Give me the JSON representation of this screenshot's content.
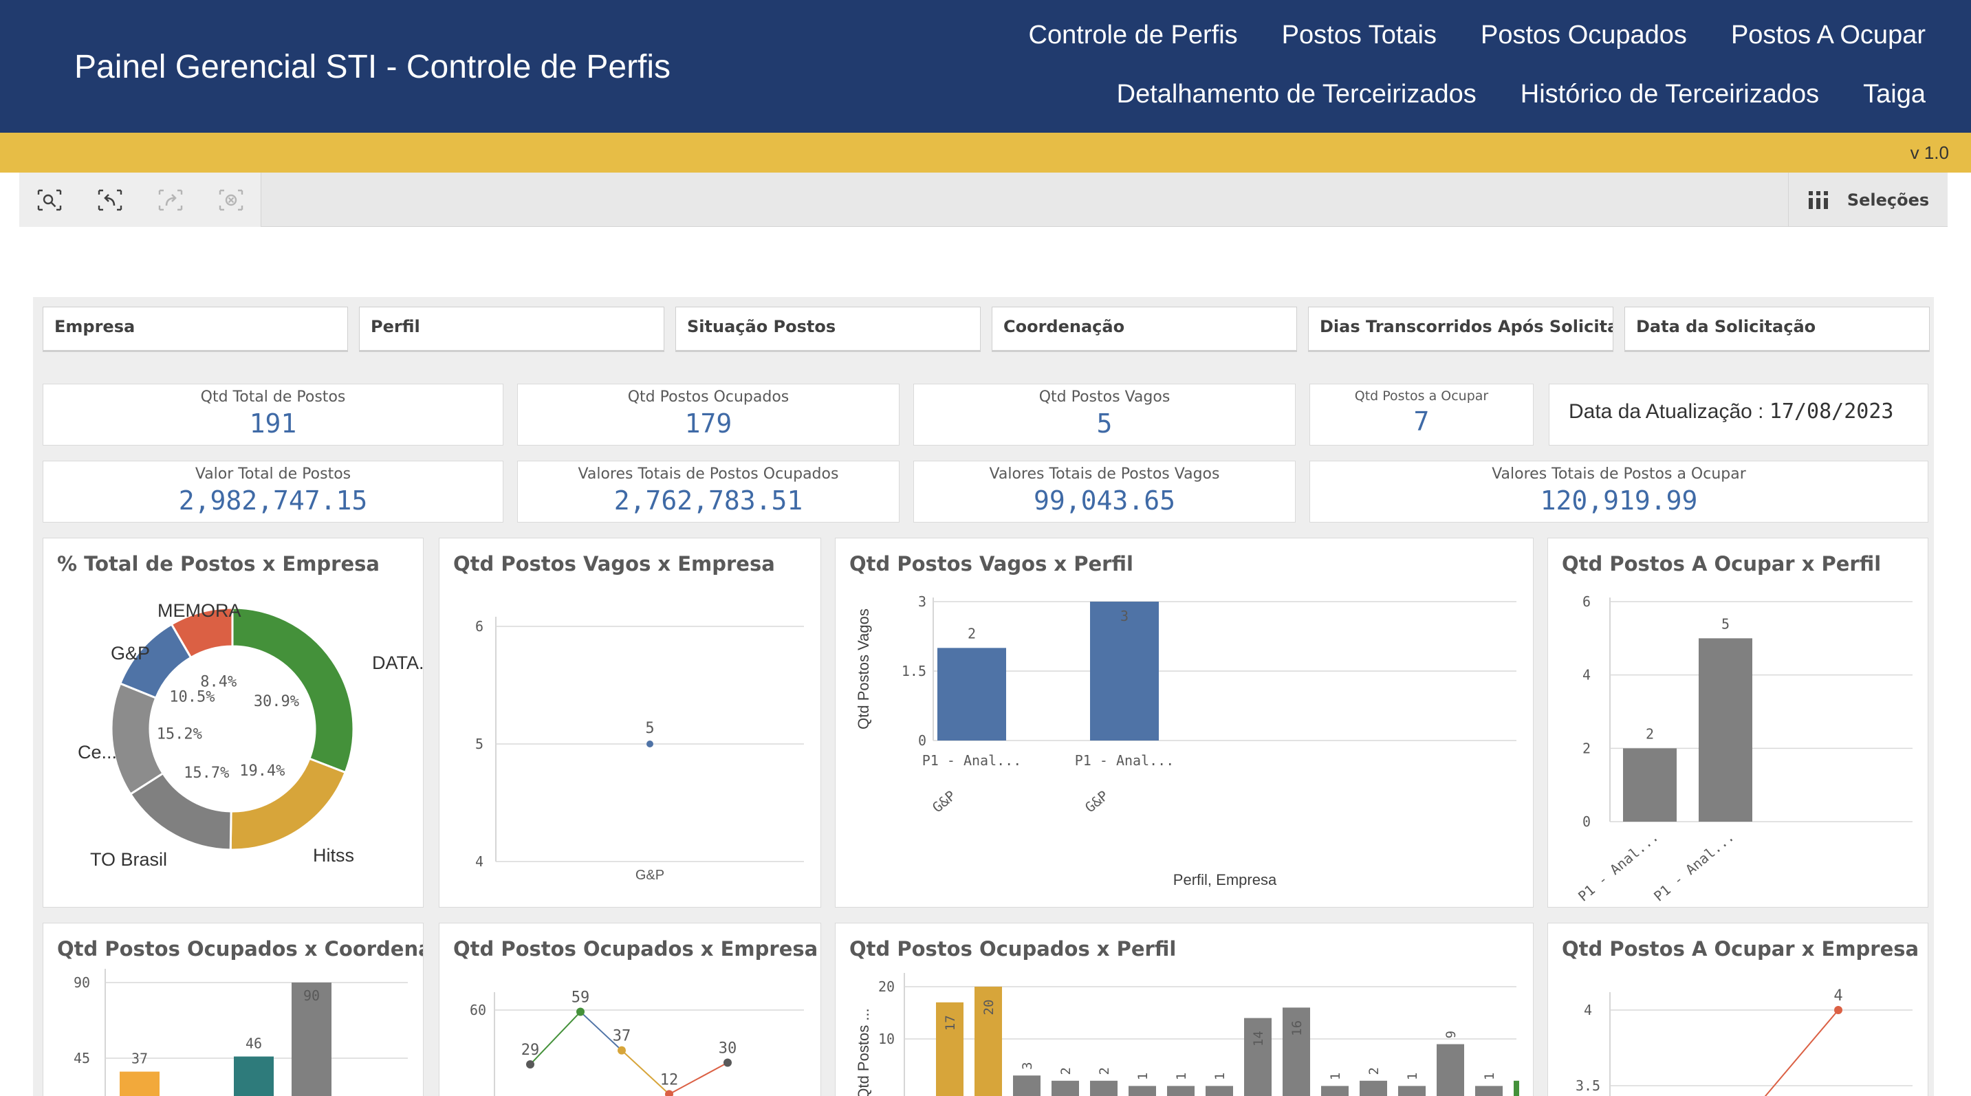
{
  "header": {
    "title": "Painel Gerencial STI - Controle de Perfis",
    "nav_row1": [
      "Controle de Perfis",
      "Postos Totais",
      "Postos Ocupados",
      "Postos A Ocupar"
    ],
    "nav_row2": [
      "Detalhamento de Terceirizados",
      "Histórico de Terceirizados",
      "Taiga"
    ]
  },
  "version": "v 1.0",
  "toolbar": {
    "tools": [
      "smart-search-icon",
      "step-back-icon",
      "step-forward-icon",
      "clear-selections-icon"
    ],
    "selections_label": "Seleções"
  },
  "filters": [
    "Empresa",
    "Perfil",
    "Situação Postos",
    "Coordenação",
    "Dias Transcorridos Após Solicita...",
    "Data da Solicitação"
  ],
  "kpis": {
    "total": {
      "label": "Qtd Total de Postos",
      "value": "191"
    },
    "ocupados": {
      "label": "Qtd Postos Ocupados",
      "value": "179"
    },
    "vagos": {
      "label": "Qtd Postos Vagos",
      "value": "5"
    },
    "a_ocupar": {
      "label": "Qtd Postos a Ocupar",
      "value": "7"
    },
    "valor_total": {
      "label": "Valor Total de Postos",
      "value": "2,982,747.15"
    },
    "valor_ocupados": {
      "label": "Valores Totais de Postos Ocupados",
      "value": "2,762,783.51"
    },
    "valor_vagos": {
      "label": "Valores Totais de Postos Vagos",
      "value": "99,043.65"
    },
    "valor_a_ocupar": {
      "label": "Valores Totais de Postos a Ocupar",
      "value": "120,919.99"
    }
  },
  "update": {
    "label": "Data da Atualização :",
    "date": "17/08/2023"
  },
  "colors": {
    "header": "#213b6e",
    "accent_bar": "#e7bd46",
    "kpi_value": "#3f6aa6",
    "bar_blue": "#4f73a6",
    "bar_gray": "#808080",
    "green": "#44913a",
    "gold": "#d7a53a",
    "red": "#db6044",
    "teal": "#2e7b7b",
    "orange": "#f2a93b"
  },
  "chart_data": [
    {
      "type": "pie",
      "title": "% Total de Postos x Empresa",
      "categories": [
        "DATA...",
        "Hitss",
        "TO Brasil",
        "Ce...",
        "G&P",
        "MEMORA"
      ],
      "values": [
        30.9,
        19.4,
        15.7,
        15.2,
        10.5,
        8.4
      ],
      "labels": [
        "30.9%",
        "19.4%",
        "15.7%",
        "15.2%",
        "10.5%",
        "8.4%"
      ],
      "colors": [
        "#44913a",
        "#d7a53a",
        "#808080",
        "#8c8c8c",
        "#4f73a6",
        "#db6044"
      ]
    },
    {
      "type": "line",
      "title": "Qtd Postos Vagos x Empresa",
      "categories": [
        "G&P"
      ],
      "values": [
        5
      ],
      "ylim": [
        4,
        6
      ],
      "yticks": [
        6,
        5,
        4
      ]
    },
    {
      "type": "bar",
      "title": "Qtd Postos Vagos x Perfil",
      "ylabel": "Qtd Postos Vagos",
      "xlabel": "Perfil, Empresa",
      "categories": [
        "P1 - Anal...",
        "P1 - Anal..."
      ],
      "subcategories": [
        "G&P",
        "G&P"
      ],
      "values": [
        2,
        3
      ],
      "ylim": [
        0,
        3
      ],
      "yticks": [
        "3",
        "1.5",
        "0"
      ]
    },
    {
      "type": "bar",
      "title": "Qtd Postos A Ocupar x Perfil",
      "categories": [
        "P1 - Anal...",
        "P1 - Anal..."
      ],
      "values": [
        2,
        5
      ],
      "ylim": [
        0,
        6
      ],
      "yticks": [
        6,
        4,
        2,
        0
      ]
    },
    {
      "type": "bar",
      "title": "Qtd Postos Ocupados x Coordenação",
      "values": [
        37,
        46,
        90
      ],
      "ylim": [
        0,
        90
      ],
      "yticks": [
        90,
        45
      ]
    },
    {
      "type": "line",
      "title": "Qtd Postos Ocupados x Empresa",
      "points": [
        29,
        59,
        37,
        12,
        30
      ],
      "yticks": [
        60
      ]
    },
    {
      "type": "bar",
      "title": "Qtd Postos Ocupados x Perfil",
      "ylabel": "Qtd Postos ...",
      "values": [
        17,
        20,
        3,
        2,
        2,
        1,
        1,
        1,
        14,
        16,
        1,
        2,
        1,
        9,
        1
      ],
      "ylim": [
        0,
        20
      ],
      "yticks": [
        20,
        10
      ]
    },
    {
      "type": "line",
      "title": "Qtd Postos A Ocupar x Empresa",
      "values": [
        4
      ],
      "yticks": [
        4,
        3.5
      ]
    }
  ]
}
